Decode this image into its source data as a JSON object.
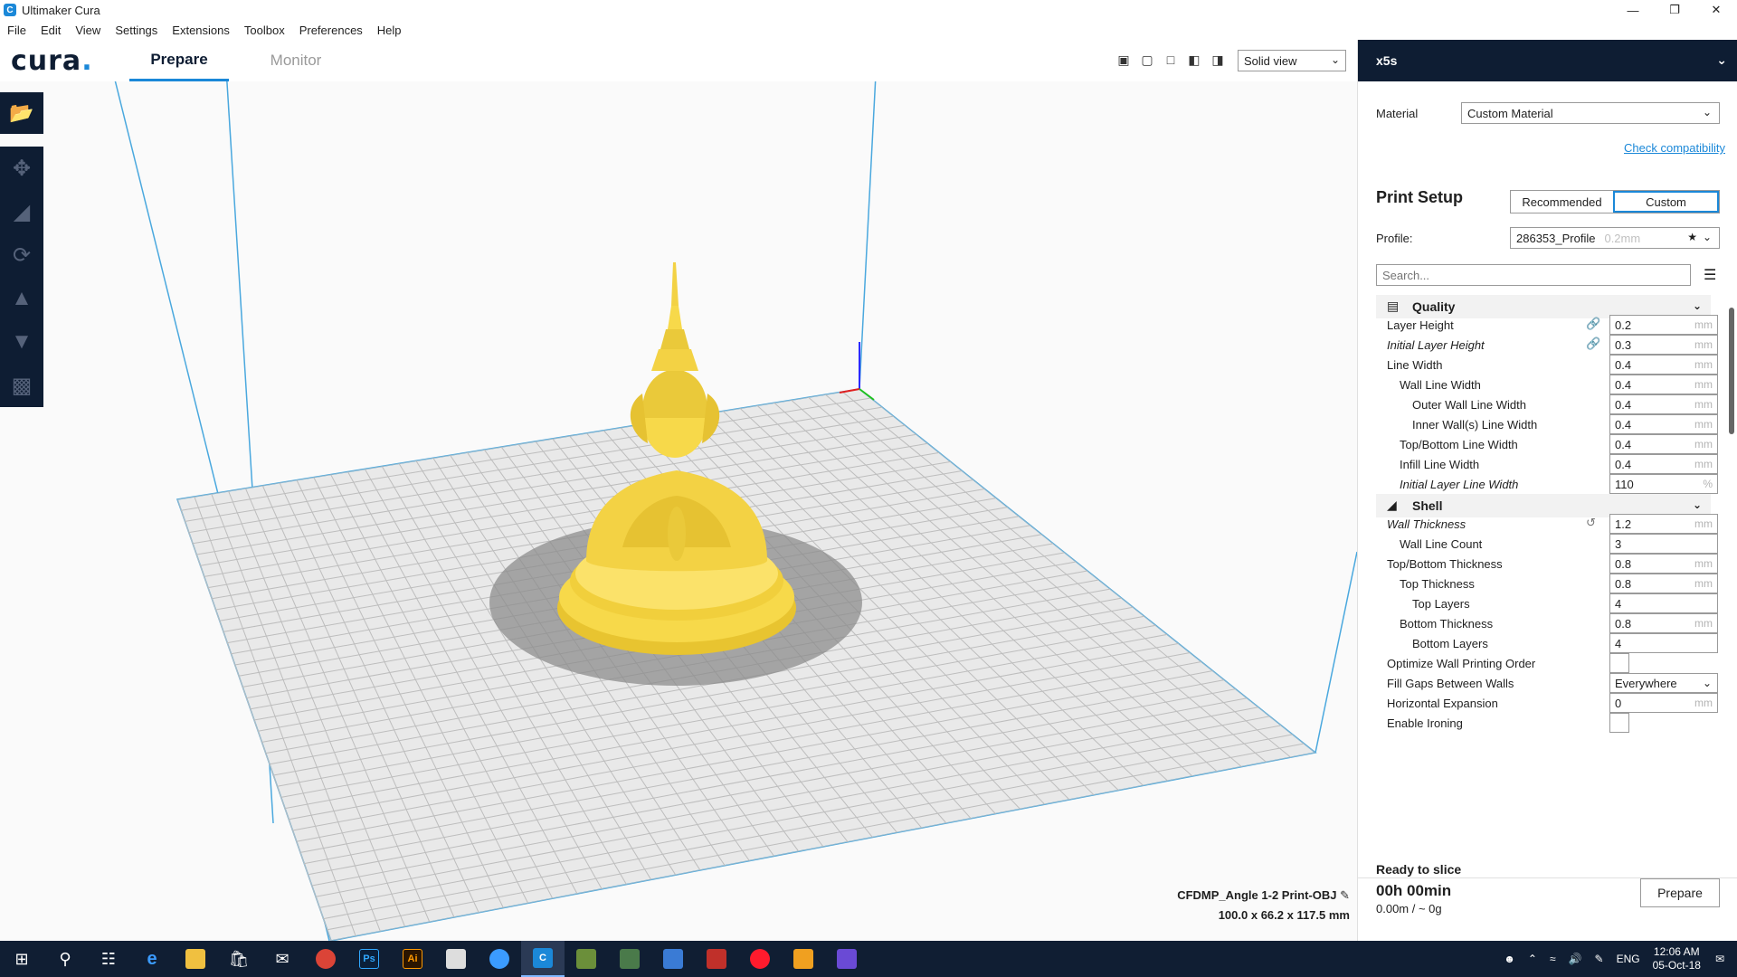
{
  "window": {
    "title": "Ultimaker Cura"
  },
  "menu": [
    "File",
    "Edit",
    "View",
    "Settings",
    "Extensions",
    "Toolbox",
    "Preferences",
    "Help"
  ],
  "header": {
    "logo": "cura",
    "logo_dot": ".",
    "tabs": [
      {
        "label": "Prepare",
        "active": true
      },
      {
        "label": "Monitor",
        "active": false
      }
    ],
    "view_mode": "Solid view",
    "view_icons": [
      "3d-view-icon",
      "front-view-icon",
      "top-view-icon",
      "left-view-icon",
      "right-view-icon"
    ]
  },
  "toolbar": {
    "open_icon": "folder-open-icon",
    "tools": [
      "move-icon",
      "scale-icon",
      "rotate-icon",
      "mirror-icon",
      "per-model-settings-icon",
      "support-blocker-icon"
    ]
  },
  "model": {
    "name": "CFDMP_Angle 1-2 Print-OBJ",
    "dimensions": "100.0 x 66.2 x 117.5 mm"
  },
  "panel": {
    "printer": "x5s",
    "material_label": "Material",
    "material_value": "Custom Material",
    "check_compat": "Check compatibility",
    "print_setup_title": "Print Setup",
    "mode_recommended": "Recommended",
    "mode_custom": "Custom",
    "profile_label": "Profile:",
    "profile_name": "286353_Profile",
    "profile_layer": "0.2mm",
    "search_placeholder": "Search...",
    "quality_label": "Quality",
    "shell_label": "Shell",
    "settings": [
      {
        "label": "Layer Height",
        "value": "0.2",
        "unit": "mm",
        "indent": 0,
        "italic": false,
        "icon": "link-icon"
      },
      {
        "label": "Initial Layer Height",
        "value": "0.3",
        "unit": "mm",
        "indent": 0,
        "italic": true,
        "icon": "link-icon"
      },
      {
        "label": "Line Width",
        "value": "0.4",
        "unit": "mm",
        "indent": 0,
        "italic": false
      },
      {
        "label": "Wall Line Width",
        "value": "0.4",
        "unit": "mm",
        "indent": 1,
        "italic": false
      },
      {
        "label": "Outer Wall Line Width",
        "value": "0.4",
        "unit": "mm",
        "indent": 2,
        "italic": false
      },
      {
        "label": "Inner Wall(s) Line Width",
        "value": "0.4",
        "unit": "mm",
        "indent": 2,
        "italic": false
      },
      {
        "label": "Top/Bottom Line Width",
        "value": "0.4",
        "unit": "mm",
        "indent": 1,
        "italic": false
      },
      {
        "label": "Infill Line Width",
        "value": "0.4",
        "unit": "mm",
        "indent": 1,
        "italic": false
      },
      {
        "label": "Initial Layer Line Width",
        "value": "110",
        "unit": "%",
        "indent": 1,
        "italic": true
      }
    ],
    "shell_settings": [
      {
        "label": "Wall Thickness",
        "value": "1.2",
        "unit": "mm",
        "indent": 0,
        "italic": true,
        "icon": "reset-icon"
      },
      {
        "label": "Wall Line Count",
        "value": "3",
        "unit": "",
        "indent": 1,
        "italic": false
      },
      {
        "label": "Top/Bottom Thickness",
        "value": "0.8",
        "unit": "mm",
        "indent": 0,
        "italic": false
      },
      {
        "label": "Top Thickness",
        "value": "0.8",
        "unit": "mm",
        "indent": 1,
        "italic": false
      },
      {
        "label": "Top Layers",
        "value": "4",
        "unit": "",
        "indent": 2,
        "italic": false
      },
      {
        "label": "Bottom Thickness",
        "value": "0.8",
        "unit": "mm",
        "indent": 1,
        "italic": false
      },
      {
        "label": "Bottom Layers",
        "value": "4",
        "unit": "",
        "indent": 2,
        "italic": false
      },
      {
        "label": "Optimize Wall Printing Order",
        "type": "checkbox",
        "indent": 0,
        "italic": false
      },
      {
        "label": "Fill Gaps Between Walls",
        "value": "Everywhere",
        "type": "select",
        "indent": 0,
        "italic": false
      },
      {
        "label": "Horizontal Expansion",
        "value": "0",
        "unit": "mm",
        "indent": 0,
        "italic": false
      },
      {
        "label": "Enable Ironing",
        "type": "checkbox",
        "indent": 0,
        "italic": false
      }
    ],
    "ready_label": "Ready to slice",
    "time": "00h 00min",
    "usage": "0.00m / ~ 0g",
    "prepare_button": "Prepare"
  },
  "taskbar": {
    "apps": [
      "windows-start-icon",
      "search-icon",
      "task-view-icon",
      "edge-icon",
      "file-explorer-icon",
      "store-icon",
      "mail-icon",
      "chrome-icon",
      "photoshop-icon",
      "illustrator-icon",
      "image-app-icon",
      "browser-icon",
      "cura-icon",
      "app-icon",
      "app-icon",
      "visual-studio-icon",
      "app-icon",
      "opera-icon",
      "app-icon",
      "app-icon"
    ],
    "app_labels": {
      "photoshop": "Ps",
      "illustrator": "Ai",
      "cura": "C",
      "edge": "e"
    },
    "language": "ENG",
    "time": "12:06 AM",
    "date": "05-Oct-18"
  },
  "colors": {
    "accent": "#1b88d8",
    "dark": "#0e1d33",
    "model": "#f7d94a",
    "grid": "#c8c8c8"
  }
}
